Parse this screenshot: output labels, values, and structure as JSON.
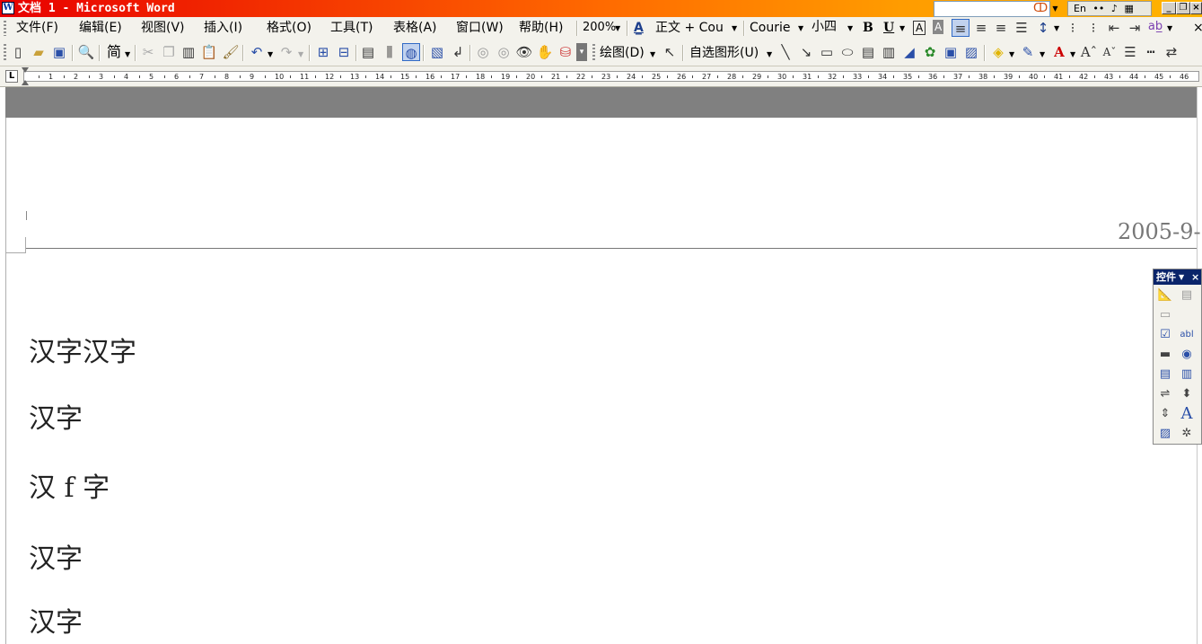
{
  "window": {
    "title": "文档 1 - Microsoft Word",
    "app_icon": "W",
    "ime": [
      "En",
      "••",
      "♪",
      "▦",
      "▤"
    ],
    "buttons": {
      "minimize": "_",
      "restore": "❐",
      "close": "×"
    }
  },
  "menu": {
    "items": [
      "文件(F)",
      "编辑(E)",
      "视图(V)",
      "插入(I)",
      "格式(O)",
      "工具(T)",
      "表格(A)",
      "窗口(W)",
      "帮助(H)"
    ],
    "zoom": "200%",
    "style": "正文 + Cou",
    "font": "Courie",
    "font_size": "小四",
    "bold": "B",
    "underline": "U",
    "char_border": "A",
    "char_shade": "A",
    "close_doc": "×"
  },
  "toolbar": {
    "traditional": "简",
    "draw_menu": "绘图(D)",
    "autoshapes": "自选图形(U)"
  },
  "ruler": {
    "corner": "L",
    "numbers": [
      "1",
      "2",
      "3",
      "4",
      "5",
      "6",
      "7",
      "8",
      "9",
      "10",
      "11",
      "12",
      "13",
      "14",
      "15",
      "16",
      "17",
      "18",
      "19",
      "20",
      "21",
      "22",
      "23",
      "24",
      "25",
      "26",
      "27",
      "28",
      "29",
      "30",
      "31",
      "32",
      "33",
      "34",
      "35",
      "36",
      "37",
      "38",
      "39",
      "40",
      "41",
      "42",
      "43",
      "44",
      "45",
      "46"
    ]
  },
  "document": {
    "header_date": "2005-9-",
    "lines": [
      "汉字汉字",
      "汉字",
      "汉 f 字",
      "汉字",
      "汉字"
    ]
  },
  "toolbox": {
    "title": "控件",
    "close": "×"
  }
}
